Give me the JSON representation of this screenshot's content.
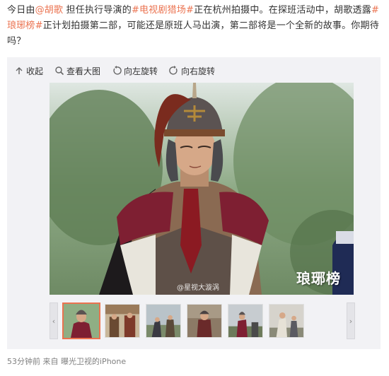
{
  "post": {
    "p1": "今日由",
    "mention": "@胡歌",
    "p2": " 担任执行导演的",
    "tag1": "#电视剧猎场#",
    "p3": "正在杭州拍摄中。在探班活动中，胡歌透露",
    "tag2": "#琅琊榜#",
    "p4": "正计划拍摄第二部，可能还是原班人马出演，第二部将是一个全新的故事。你期待吗？"
  },
  "toolbar": {
    "collapse": "收起",
    "view_large": "查看大图",
    "rotate_left": "向左旋转",
    "rotate_right": "向右旋转"
  },
  "photo": {
    "watermark_logo": "琅琊榜",
    "watermark_source": "@星视大漩涡"
  },
  "thumbnails": {
    "count_visible": 6,
    "selected_index": 0
  },
  "footer": {
    "time": "53分钟前",
    "from_prefix": " 来自 ",
    "source": "曝光卫视的iPhone"
  },
  "colors": {
    "link": "#eb7350",
    "text": "#333333",
    "muted": "#808080",
    "panel": "#f2f2f5"
  }
}
